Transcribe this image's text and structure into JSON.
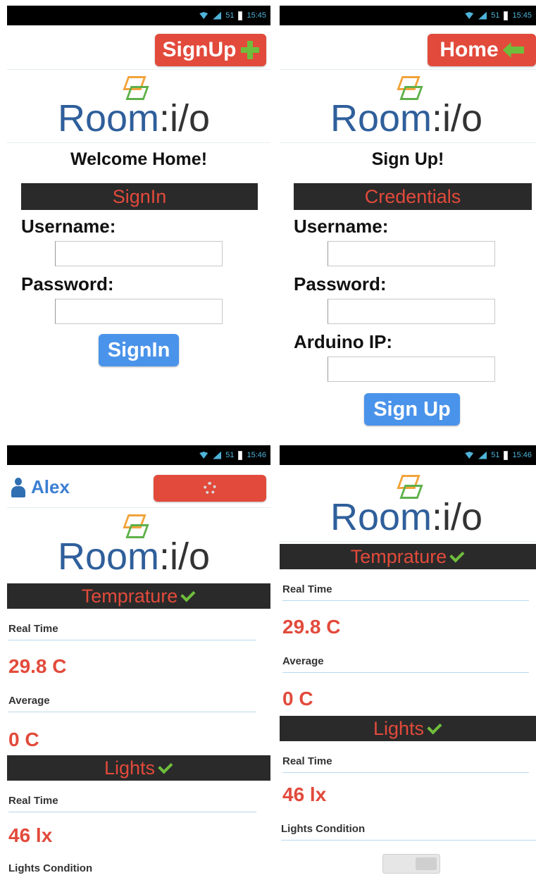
{
  "status_bar": {
    "signal": "51",
    "time_tl": "15:45",
    "time_tr": "15:45",
    "time_bl": "15:46",
    "time_br": "15:46"
  },
  "logo": {
    "room": "Room",
    "io": ":i/o"
  },
  "colors": {
    "accent_red": "#e24a3b",
    "accent_blue": "#4a93ea",
    "accent_green": "#6fbd3c",
    "dark_bar": "#2a2a2a",
    "logo_blue": "#2f5f9b"
  },
  "signin_screen": {
    "header_button": "SignUp",
    "title": "Welcome Home!",
    "section": "SignIn",
    "username_label": "Username:",
    "password_label": "Password:",
    "username_value": "",
    "password_value": "",
    "submit_button": "SignIn"
  },
  "signup_screen": {
    "header_button": "Home",
    "title": "Sign Up!",
    "section": "Credentials",
    "username_label": "Username:",
    "password_label": "Password:",
    "arduino_label": "Arduino IP:",
    "submit_button": "Sign Up"
  },
  "dashboard": {
    "user_name": "Alex",
    "temperature_section": "Temprature",
    "real_time_label": "Real Time",
    "temp_real_time": "29.8 C",
    "average_label": "Average",
    "temp_average": "0 C",
    "lights_section": "Lights",
    "lights_real_time_label": "Real Time",
    "lights_real_time": "46 lx",
    "lights_condition_label": "Lights Condition",
    "lights_condition_on": false
  }
}
